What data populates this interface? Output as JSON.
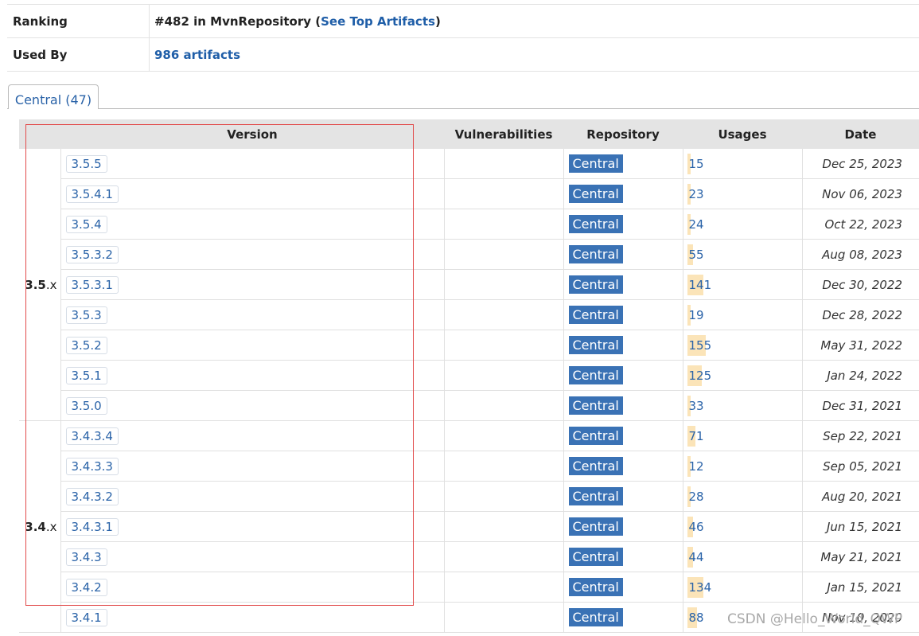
{
  "info": {
    "ranking_label": "Ranking",
    "ranking_prefix": "#482 in MvnRepository (",
    "ranking_link": "See Top Artifacts",
    "ranking_suffix": ")",
    "usedby_label": "Used By",
    "usedby_value": "986 artifacts"
  },
  "tab": {
    "label": "Central (47)"
  },
  "columns": {
    "version": "Version",
    "vulnerabilities": "Vulnerabilities",
    "repository": "Repository",
    "usages": "Usages",
    "date": "Date"
  },
  "groups": [
    {
      "major": "3.5",
      "suffix": ".x",
      "rows": [
        {
          "version": "3.5.5",
          "repository": "Central",
          "usages": "15",
          "usage_fraction": 0.02,
          "date": "Dec 25, 2023"
        },
        {
          "version": "3.5.4.1",
          "repository": "Central",
          "usages": "23",
          "usage_fraction": 0.03,
          "date": "Nov 06, 2023"
        },
        {
          "version": "3.5.4",
          "repository": "Central",
          "usages": "24",
          "usage_fraction": 0.03,
          "date": "Oct 22, 2023"
        },
        {
          "version": "3.5.3.2",
          "repository": "Central",
          "usages": "55",
          "usage_fraction": 0.05,
          "date": "Aug 08, 2023"
        },
        {
          "version": "3.5.3.1",
          "repository": "Central",
          "usages": "141",
          "usage_fraction": 0.14,
          "date": "Dec 30, 2022"
        },
        {
          "version": "3.5.3",
          "repository": "Central",
          "usages": "19",
          "usage_fraction": 0.02,
          "date": "Dec 28, 2022"
        },
        {
          "version": "3.5.2",
          "repository": "Central",
          "usages": "155",
          "usage_fraction": 0.16,
          "date": "May 31, 2022"
        },
        {
          "version": "3.5.1",
          "repository": "Central",
          "usages": "125",
          "usage_fraction": 0.13,
          "date": "Jan 24, 2022"
        },
        {
          "version": "3.5.0",
          "repository": "Central",
          "usages": "33",
          "usage_fraction": 0.03,
          "date": "Dec 31, 2021"
        }
      ]
    },
    {
      "major": "3.4",
      "suffix": ".x",
      "rows": [
        {
          "version": "3.4.3.4",
          "repository": "Central",
          "usages": "71",
          "usage_fraction": 0.07,
          "date": "Sep 22, 2021"
        },
        {
          "version": "3.4.3.3",
          "repository": "Central",
          "usages": "12",
          "usage_fraction": 0.015,
          "date": "Sep 05, 2021"
        },
        {
          "version": "3.4.3.2",
          "repository": "Central",
          "usages": "28",
          "usage_fraction": 0.03,
          "date": "Aug 20, 2021"
        },
        {
          "version": "3.4.3.1",
          "repository": "Central",
          "usages": "46",
          "usage_fraction": 0.05,
          "date": "Jun 15, 2021"
        },
        {
          "version": "3.4.3",
          "repository": "Central",
          "usages": "44",
          "usage_fraction": 0.05,
          "date": "May 21, 2021"
        },
        {
          "version": "3.4.2",
          "repository": "Central",
          "usages": "134",
          "usage_fraction": 0.14,
          "date": "Jan 15, 2021"
        },
        {
          "version": "3.4.1",
          "repository": "Central",
          "usages": "88",
          "usage_fraction": 0.09,
          "date": "Nov 10, 2020"
        }
      ]
    }
  ],
  "watermark": "CSDN @Hello_World_QWP",
  "colors": {
    "link": "#1f5ea8",
    "repo_badge": "#3a72b5",
    "usage_bar": "#fbe4b8",
    "annotation_box": "#e24b4b"
  }
}
